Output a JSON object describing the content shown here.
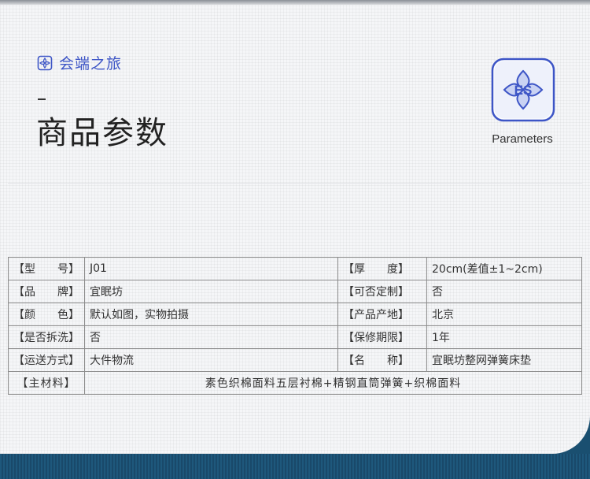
{
  "header": {
    "brand_name": "会端之旅",
    "title": "商品参数",
    "badge_label": "Parameters",
    "badge_letters": "ES",
    "dash": "-"
  },
  "colors": {
    "brand_blue": "#3d55c6",
    "bottom_band": "#1a4f70",
    "table_border": "#8c8c8c"
  },
  "icons": {
    "brand": "flower-logo-icon",
    "badge": "es-flower-badge-icon"
  },
  "params": {
    "rows": [
      {
        "label1": "【型　　号】",
        "value1": "J01",
        "label2": "【厚　　度】",
        "value2": "20cm(差值±1~2cm)"
      },
      {
        "label1": "【品　　牌】",
        "value1": "宜眠坊",
        "label2": "【可否定制】",
        "value2": "否"
      },
      {
        "label1": "【颜　　色】",
        "value1": "默认如图，实物拍摄",
        "label2": "【产品产地】",
        "value2": "北京"
      },
      {
        "label1": "【是否拆洗】",
        "value1": "否",
        "label2": "【保修期限】",
        "value2": "1年"
      },
      {
        "label1": "【运送方式】",
        "value1": "大件物流",
        "label2": "【名　　称】",
        "value2": "宜眠坊整网弹簧床垫"
      }
    ],
    "material_label": "【主材料】",
    "material_value": "素色织棉面料五层衬棉+精钢直筒弹簧+织棉面料"
  }
}
